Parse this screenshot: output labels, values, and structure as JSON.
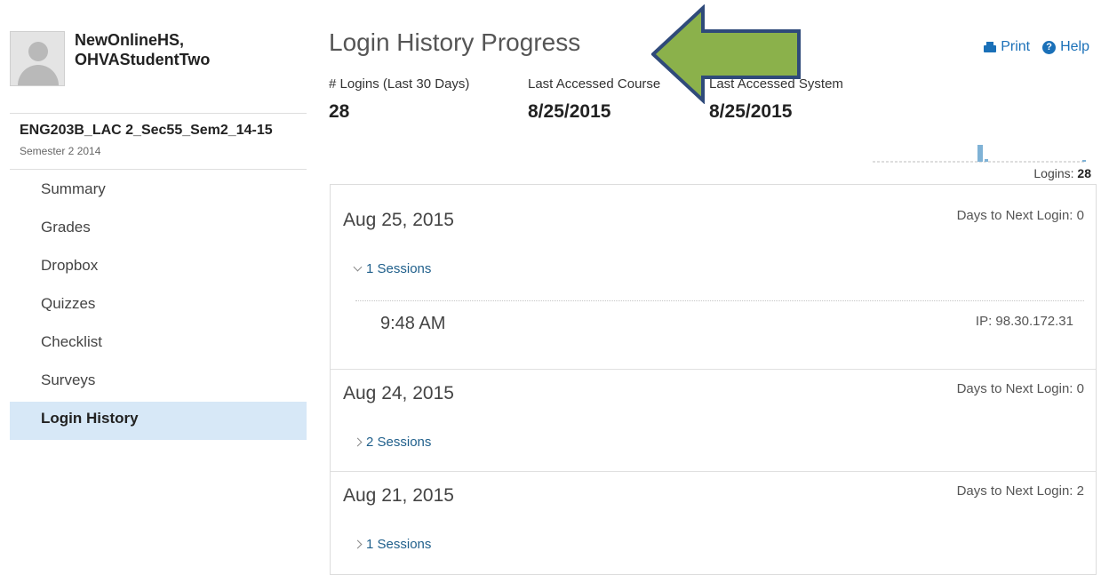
{
  "user": {
    "name_line1": "NewOnlineHS,",
    "name_line2": "OHVAStudentTwo"
  },
  "course": {
    "name": "ENG203B_LAC 2_Sec55_Sem2_14-15",
    "term": "Semester 2 2014"
  },
  "nav": [
    {
      "label": "Summary"
    },
    {
      "label": "Grades"
    },
    {
      "label": "Dropbox"
    },
    {
      "label": "Quizzes"
    },
    {
      "label": "Checklist"
    },
    {
      "label": "Surveys"
    },
    {
      "label": "Login History",
      "active": true
    }
  ],
  "header": {
    "title": "Login History Progress",
    "print_label": "Print",
    "help_label": "Help",
    "stats": [
      {
        "label": "# Logins (Last 30 Days)",
        "value": "28"
      },
      {
        "label": "Last Accessed Course",
        "value": "8/25/2015"
      },
      {
        "label": "Last Accessed System",
        "value": "8/25/2015"
      }
    ],
    "logins_label": "Logins:",
    "logins_value": "28"
  },
  "days": [
    {
      "date": "Aug 25, 2015",
      "next_login": "Days to Next Login: 0",
      "sessions_label": "1 Sessions",
      "expanded": true,
      "sessions": [
        {
          "time": "9:48 AM",
          "ip": "IP: 98.30.172.31"
        }
      ]
    },
    {
      "date": "Aug 24, 2015",
      "next_login": "Days to Next Login: 0",
      "sessions_label": "2 Sessions",
      "expanded": false
    },
    {
      "date": "Aug 21, 2015",
      "next_login": "Days to Next Login: 2",
      "sessions_label": "1 Sessions",
      "expanded": false
    }
  ],
  "colors": {
    "accent": "#1a70b8",
    "active_nav": "#d7e8f7",
    "arrow": "#8bb14b",
    "arrow_outline": "#2f4a7a",
    "spark": "#7fb2d6"
  }
}
